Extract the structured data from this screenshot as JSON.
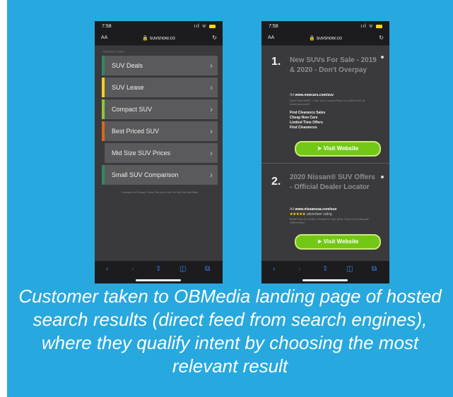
{
  "colors": {
    "background": "#27a8df",
    "visit_button": "#73c816",
    "accent_bars": [
      "#2f8a5f",
      "#f2d01f",
      "#8cc63f",
      "#d9671c",
      "#3a3a3c",
      "#2f8a5f"
    ]
  },
  "phone1": {
    "time": "7:58",
    "signal": "ııl ᯤ",
    "text_size": "AA",
    "url": "🔒 suvsnow.co",
    "reload": "↻",
    "related": "Related Links",
    "menu": [
      {
        "label": "SUV Deals"
      },
      {
        "label": "SUV Lease"
      },
      {
        "label": "Compact SUV"
      },
      {
        "label": "Best Priced SUV"
      },
      {
        "label": "Mid Size SUV Prices"
      },
      {
        "label": "Small SUV Comparison"
      }
    ],
    "footer": "Contact Us    Privacy Policy    Terms of Use    Do Not Sell My Data"
  },
  "phone2": {
    "time": "7:58",
    "signal": "ııl ᯤ",
    "text_size": "AA",
    "url": "🔒 suvsnow.co",
    "reload": "↻",
    "ads": [
      {
        "number": "1.",
        "headline": "New SUVs For Sale - 2019 & 2020 - Don't Overpay",
        "ad_label": "Ad",
        "domain": "www.newcars.com/suv",
        "desc": "Don't Pay MSRP - Find Your Lowest Price on a New SUV at NewCars.com®",
        "sitelinks": [
          "Find Clearance Sales",
          "Cheap New Cars",
          "Limited Time Offers",
          "Find Clearances"
        ],
        "button": "➤ Visit Website"
      },
      {
        "number": "2.",
        "headline": "2020 Nissan® SUV Offers - Official Dealer Locator",
        "ad_label": "Ad",
        "domain": "www.nissanusa.com/suv",
        "stars": "★★★★★",
        "rating_text": "advertiser rating",
        "desc": "Build Price & Locate a Dealer in Your Area. Find Local Nissan® Offers Now!",
        "button": "➤ Visit Website"
      }
    ]
  },
  "toolbar_icons": [
    "‹",
    "›",
    "⇪",
    "◫",
    "⧉"
  ],
  "caption": "Customer taken to OBMedia landing page of hosted search results (direct feed from search engines), where they qualify intent by choosing the most relevant result"
}
